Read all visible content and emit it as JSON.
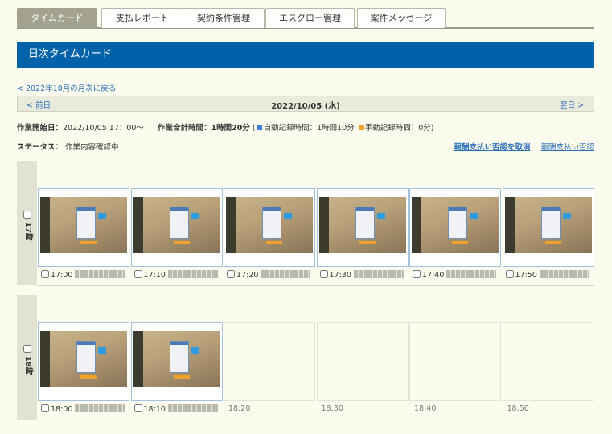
{
  "tabs": [
    {
      "label": "タイムカード",
      "active": true
    },
    {
      "label": "支払レポート",
      "active": false
    },
    {
      "label": "契約条件管理",
      "active": false
    },
    {
      "label": "エスクロー管理",
      "active": false
    },
    {
      "label": "案件メッセージ",
      "active": false
    }
  ],
  "page_title": "日次タイムカード",
  "back_link": "< 2022年10月の月次に戻る",
  "date_nav": {
    "prev": "< 前日",
    "current": "2022/10/05 (水)",
    "next": "翌日 >"
  },
  "info": {
    "start_label": "作業開始日：",
    "start_value": "2022/10/05 17：00〜",
    "total_label": "作業合計時間：1時間20分",
    "auto_label": "自動記録時間：1時間10分",
    "manual_label": "手動記録時間：0分)",
    "open_paren": "(",
    "auto_color": "#3a7fd5",
    "manual_color": "#f0a22a"
  },
  "status": {
    "label": "ステータス：",
    "value": "作業内容確認中"
  },
  "actions": {
    "cancel": "報酬支払い否認を取消",
    "deny": "報酬支払い否認"
  },
  "hours": [
    {
      "label": "17時",
      "slots": [
        {
          "time": "17:00",
          "filled": true
        },
        {
          "time": "17:10",
          "filled": true
        },
        {
          "time": "17:20",
          "filled": true
        },
        {
          "time": "17:30",
          "filled": true
        },
        {
          "time": "17:40",
          "filled": true
        },
        {
          "time": "17:50",
          "filled": true
        }
      ]
    },
    {
      "label": "18時",
      "slots": [
        {
          "time": "18:00",
          "filled": true
        },
        {
          "time": "18:10",
          "filled": true
        },
        {
          "time": "18:20",
          "filled": false
        },
        {
          "time": "18:30",
          "filled": false
        },
        {
          "time": "18:40",
          "filled": false
        },
        {
          "time": "18:50",
          "filled": false
        }
      ]
    }
  ]
}
